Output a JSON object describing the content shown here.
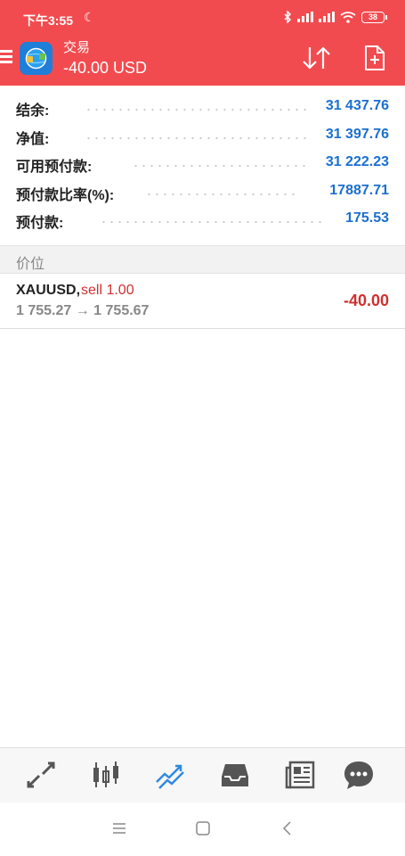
{
  "status_bar": {
    "time": "下午3:55",
    "battery": "38"
  },
  "header": {
    "title": "交易",
    "subtitle": "-40.00 USD"
  },
  "summary": [
    {
      "label": "结余:",
      "value": "31 437.76"
    },
    {
      "label": "净值:",
      "value": "31 397.76"
    },
    {
      "label": "可用预付款:",
      "value": "31 222.23"
    },
    {
      "label": "预付款比率(%):",
      "value": "17887.71"
    },
    {
      "label": "预付款:",
      "value": "175.53"
    }
  ],
  "section_title": "价位",
  "positions": [
    {
      "symbol": "XAUUSD,",
      "side": "sell 1.00",
      "prices": "1 755.27 → 1 755.67",
      "profit": "-40.00"
    }
  ],
  "bottom_nav": [
    {
      "name": "quotes-icon",
      "active": false
    },
    {
      "name": "chart-icon",
      "active": false
    },
    {
      "name": "trade-icon",
      "active": true
    },
    {
      "name": "history-icon",
      "active": false
    },
    {
      "name": "news-icon",
      "active": false
    },
    {
      "name": "messages-icon",
      "active": false
    }
  ],
  "colors": {
    "accent": "#f24b4f",
    "value_blue": "#1a6fd0",
    "loss_red": "#d03030",
    "nav_active": "#2f8ae0",
    "nav_inactive": "#555555"
  }
}
